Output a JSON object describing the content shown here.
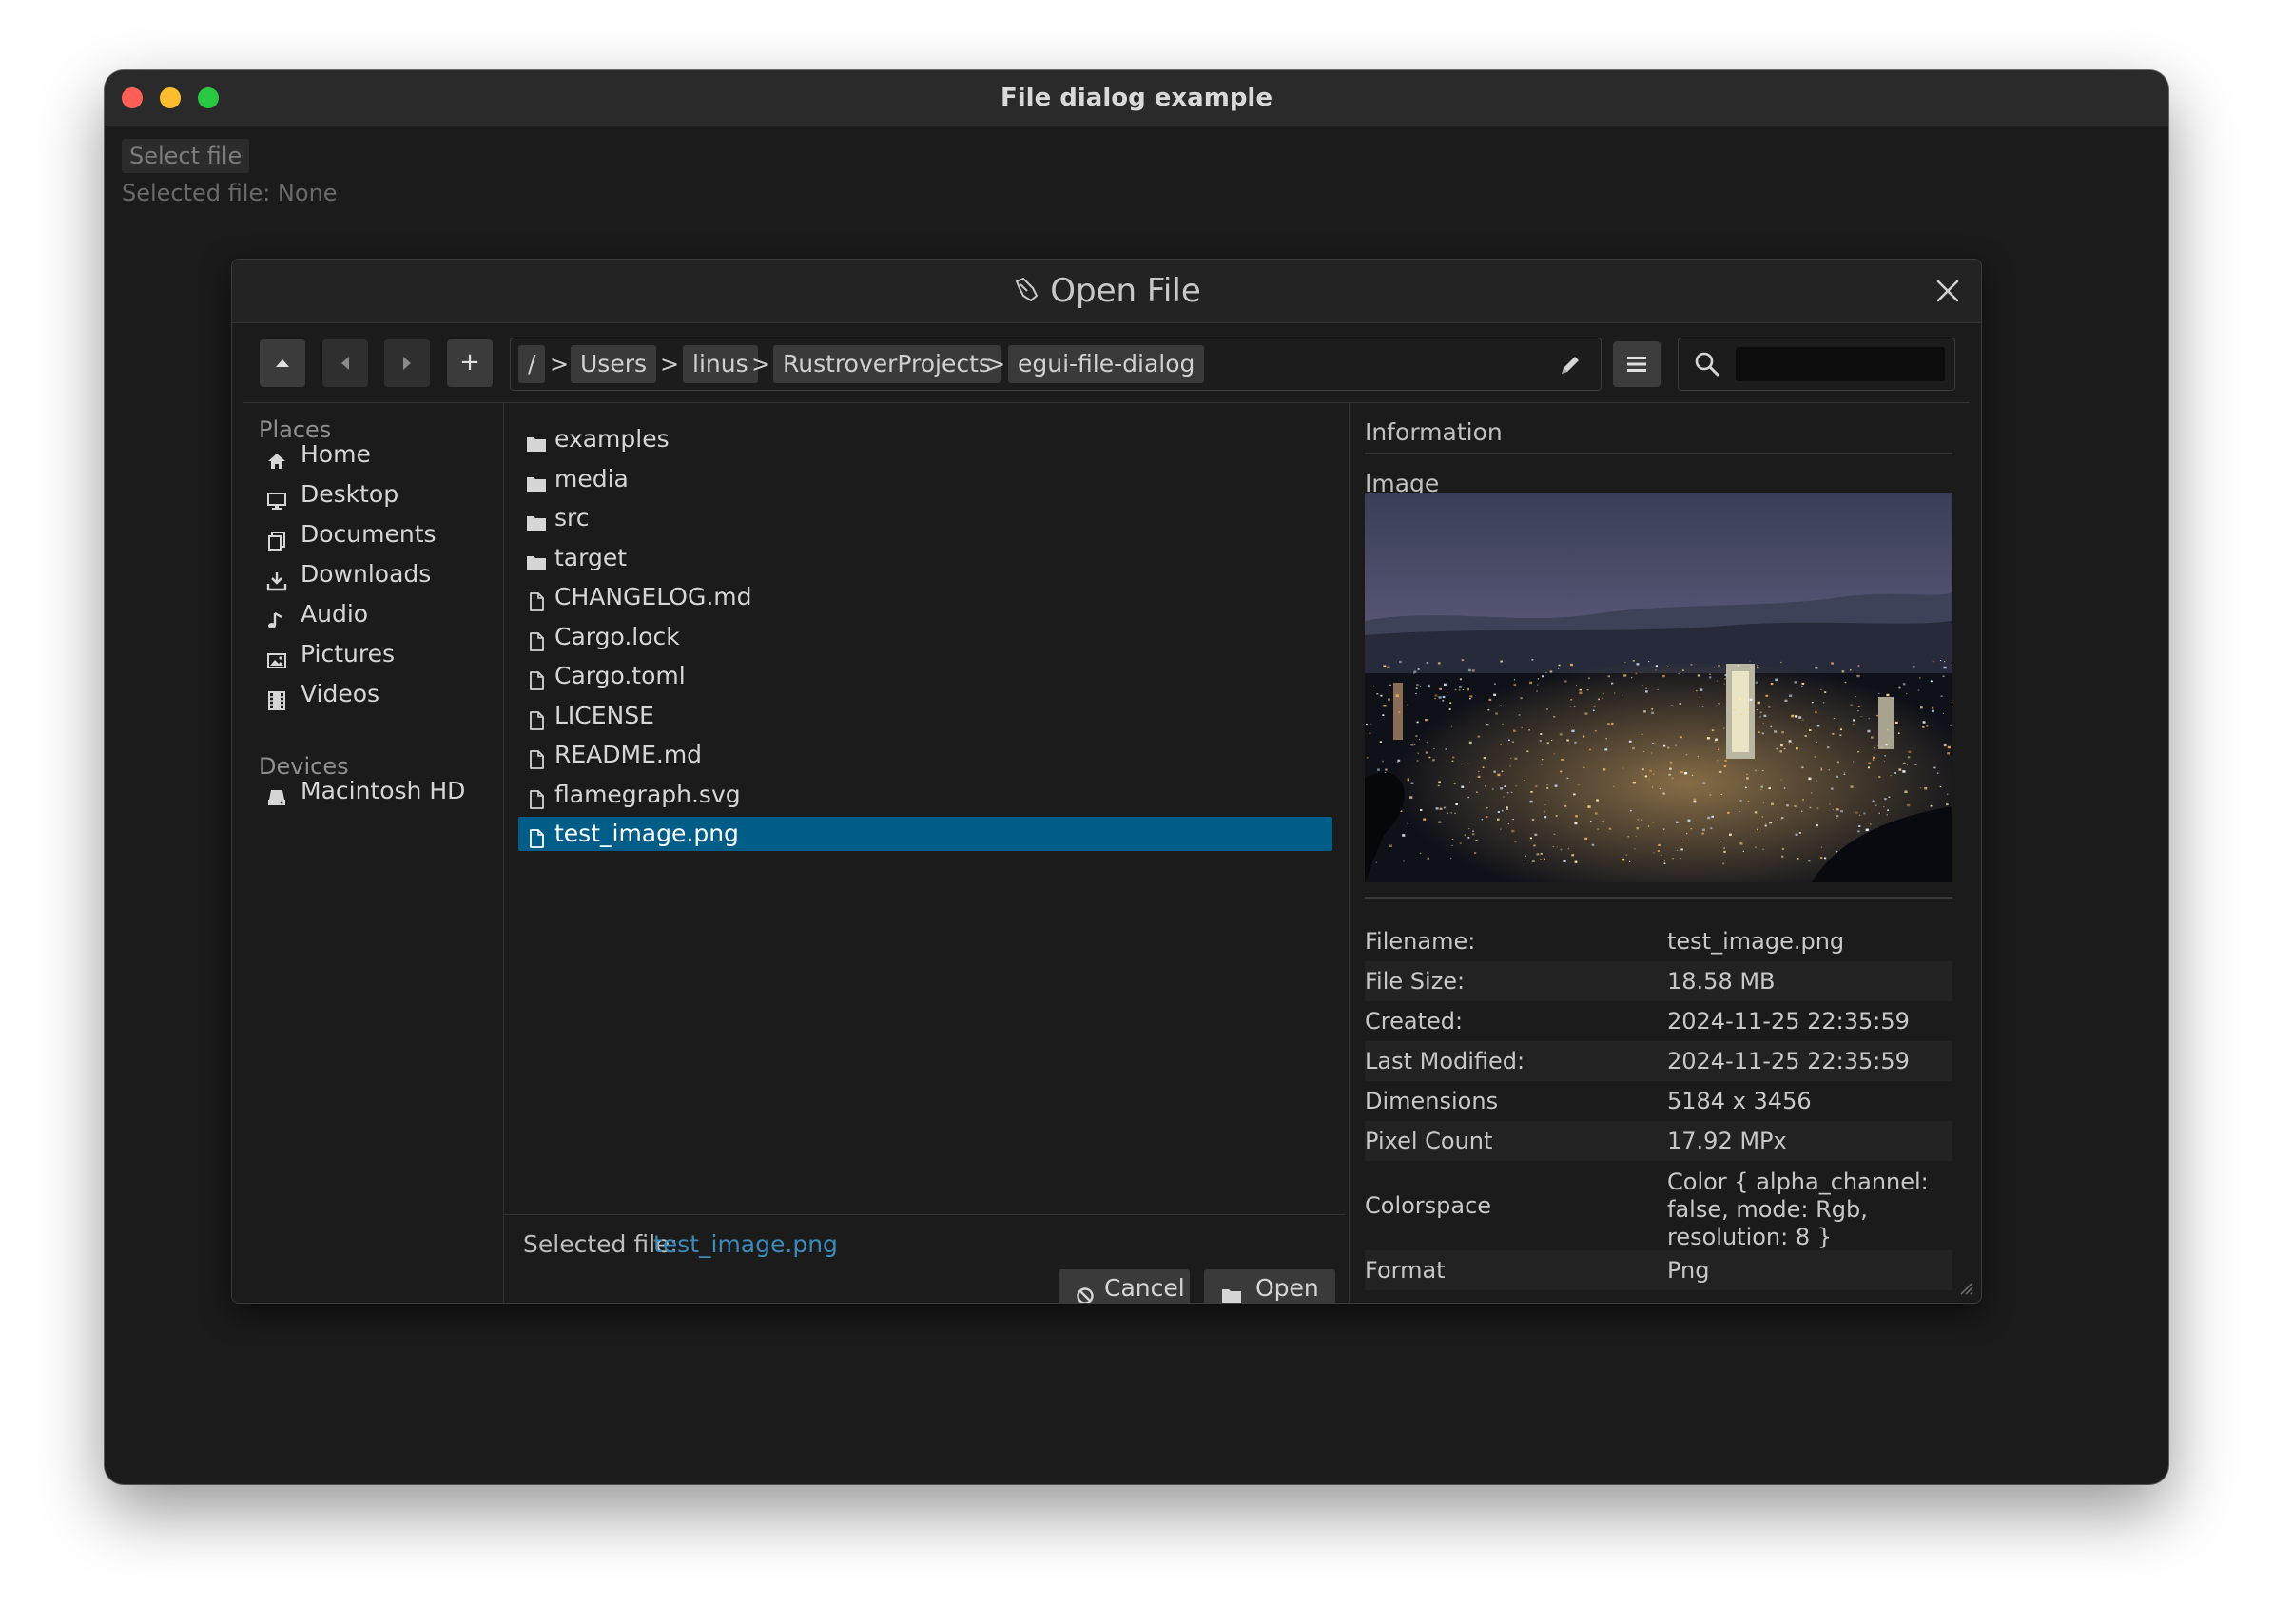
{
  "window": {
    "title": "File dialog example",
    "traffic_lights": {
      "close": "#ff5f57",
      "minimize": "#febc2e",
      "zoom": "#28c840"
    }
  },
  "app": {
    "select_button_label": "Select file",
    "status_text": "Selected file: None"
  },
  "dialog": {
    "title": "Open File",
    "title_icon": "pointing-hand-icon",
    "toolbar": {
      "up_icon": "arrow-up-icon",
      "back_icon": "arrow-left-icon",
      "forward_icon": "arrow-right-icon",
      "new_folder_label": "+",
      "breadcrumbs": [
        "/",
        "Users",
        "linus",
        "RustroverProjects",
        "egui-file-dialog"
      ],
      "breadcrumb_separator": ">",
      "edit_path_icon": "pencil-icon",
      "view_menu_icon": "hamburger-menu-icon",
      "search_icon": "magnifier-icon",
      "search_value": ""
    },
    "places": {
      "title": "Places",
      "items": [
        {
          "label": "Home",
          "icon": "home-icon"
        },
        {
          "label": "Desktop",
          "icon": "monitor-icon"
        },
        {
          "label": "Documents",
          "icon": "documents-icon"
        },
        {
          "label": "Downloads",
          "icon": "download-icon"
        },
        {
          "label": "Audio",
          "icon": "music-note-icon"
        },
        {
          "label": "Pictures",
          "icon": "picture-icon"
        },
        {
          "label": "Videos",
          "icon": "film-icon"
        }
      ]
    },
    "devices": {
      "title": "Devices",
      "items": [
        {
          "label": "Macintosh HD",
          "icon": "disk-icon"
        }
      ]
    },
    "files": [
      {
        "name": "examples",
        "type": "folder"
      },
      {
        "name": "media",
        "type": "folder"
      },
      {
        "name": "src",
        "type": "folder"
      },
      {
        "name": "target",
        "type": "folder"
      },
      {
        "name": "CHANGELOG.md",
        "type": "file"
      },
      {
        "name": "Cargo.lock",
        "type": "file"
      },
      {
        "name": "Cargo.toml",
        "type": "file"
      },
      {
        "name": "LICENSE",
        "type": "file"
      },
      {
        "name": "README.md",
        "type": "file"
      },
      {
        "name": "flamegraph.svg",
        "type": "file"
      },
      {
        "name": "test_image.png",
        "type": "file",
        "selected": true
      }
    ],
    "selection": {
      "label": "Selected file:",
      "value": "test_image.png"
    },
    "buttons": {
      "cancel_label": "Cancel",
      "open_label": "Open"
    },
    "info": {
      "title": "Information",
      "image_label": "Image",
      "rows": [
        {
          "key": "Filename:",
          "value": "test_image.png"
        },
        {
          "key": "File Size:",
          "value": "18.58 MB"
        },
        {
          "key": "Created:",
          "value": "2024-11-25 22:35:59"
        },
        {
          "key": "Last Modified:",
          "value": "2024-11-25 22:35:59"
        },
        {
          "key": "Dimensions",
          "value": "5184 x 3456"
        },
        {
          "key": "Pixel Count",
          "value": "17.92 MPx"
        },
        {
          "key": "Colorspace",
          "value": "Color { alpha_channel: false, mode: Rgb, resolution: 8 }"
        },
        {
          "key": "Format",
          "value": "Png"
        }
      ]
    },
    "colors": {
      "selection": "#005d87",
      "link": "#3c8bb8",
      "panel_bg": "#1b1b1b",
      "button_bg": "#3a3a3a"
    }
  }
}
